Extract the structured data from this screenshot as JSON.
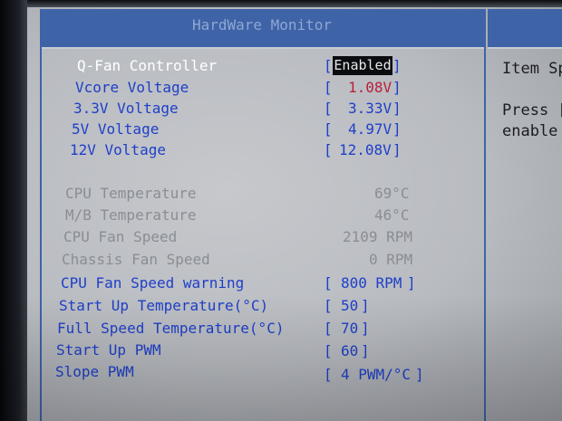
{
  "panel": {
    "title": "HardWare Monitor"
  },
  "help": {
    "line1": "Item Spe",
    "line2": "Press [",
    "line3": "enable"
  },
  "items": {
    "qfan": {
      "label": "Q-Fan Controller",
      "value": "Enabled"
    },
    "vcore": {
      "label": "Vcore Voltage",
      "value": "1.08V"
    },
    "v33": {
      "label": "3.3V Voltage",
      "value": "3.33V"
    },
    "v5": {
      "label": "5V Voltage",
      "value": "4.97V"
    },
    "v12": {
      "label": "12V Voltage",
      "value": "12.08V"
    },
    "cpu_temp": {
      "label": "CPU Temperature",
      "value": "69°C"
    },
    "mb_temp": {
      "label": "M/B Temperature",
      "value": "46°C"
    },
    "cpu_fan": {
      "label": "CPU Fan Speed",
      "value": "2109 RPM"
    },
    "chassis_fan": {
      "label": "Chassis Fan Speed",
      "value": "0 RPM"
    },
    "cpu_fan_warn": {
      "label": "CPU Fan Speed warning",
      "value": "800 RPM"
    },
    "startup_temp": {
      "label": "Start Up Temperature(°C)",
      "value": "50"
    },
    "full_temp": {
      "label": "Full Speed Temperature(°C)",
      "value": "70"
    },
    "startup_pwm": {
      "label": "Start Up PWM",
      "value": "60"
    },
    "slope_pwm": {
      "label": "Slope PWM",
      "value": "4 PWM/°C"
    }
  }
}
